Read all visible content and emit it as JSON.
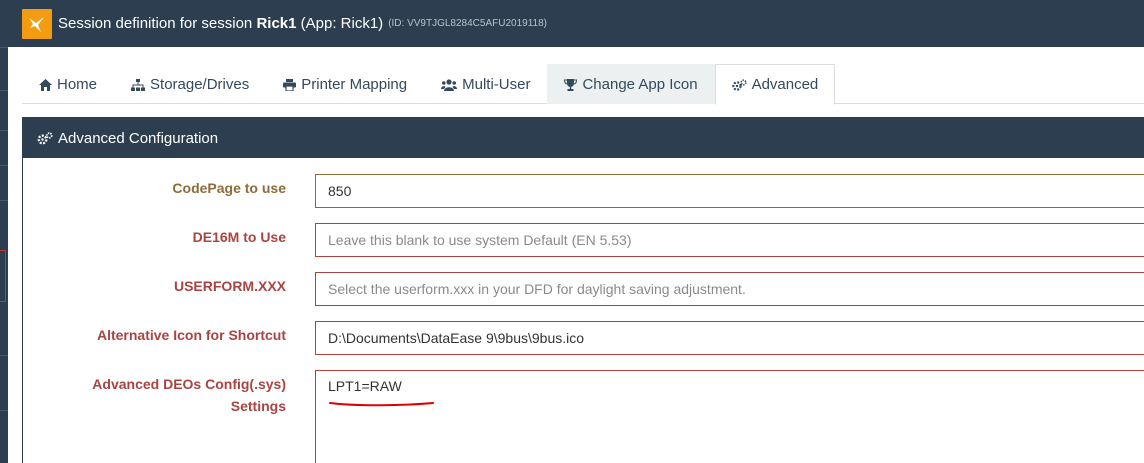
{
  "window": {
    "title_prefix": "Session definition for session ",
    "session_name": "Rick1",
    "app_part": " (App: Rick1)",
    "id_label": "(ID: VV9TJGL8284C5AFU2019118)"
  },
  "tabs": [
    {
      "label": "Home",
      "icon": "home-icon"
    },
    {
      "label": "Storage/Drives",
      "icon": "sitemap-icon"
    },
    {
      "label": "Printer Mapping",
      "icon": "printer-icon"
    },
    {
      "label": "Multi-User",
      "icon": "users-icon"
    },
    {
      "label": "Change App Icon",
      "icon": "trophy-icon"
    },
    {
      "label": "Advanced",
      "icon": "cogs-icon"
    }
  ],
  "config": {
    "header": "Advanced Configuration",
    "fields": [
      {
        "label": "CodePage to use",
        "value": "850",
        "placeholder": ""
      },
      {
        "label": "DE16M to Use",
        "value": "",
        "placeholder": "Leave this blank to use system Default (EN 5.53)"
      },
      {
        "label": "USERFORM.XXX",
        "value": "",
        "placeholder": "Select the userform.xxx in your DFD for daylight saving adjustment."
      },
      {
        "label": "Alternative Icon for Shortcut",
        "value": "D:\\Documents\\DataEase 9\\9bus\\9bus.ico",
        "placeholder": ""
      },
      {
        "label_line1": "Advanced DEOs Config(.sys)",
        "label_line2": "Settings",
        "value": "LPT1=RAW"
      }
    ]
  },
  "colors": {
    "header_bg": "#2c3e50",
    "logo_bg": "#f39c12",
    "error_red": "#a94442",
    "warning_gold": "#8a6d3b",
    "annotation_red": "#e00000"
  }
}
